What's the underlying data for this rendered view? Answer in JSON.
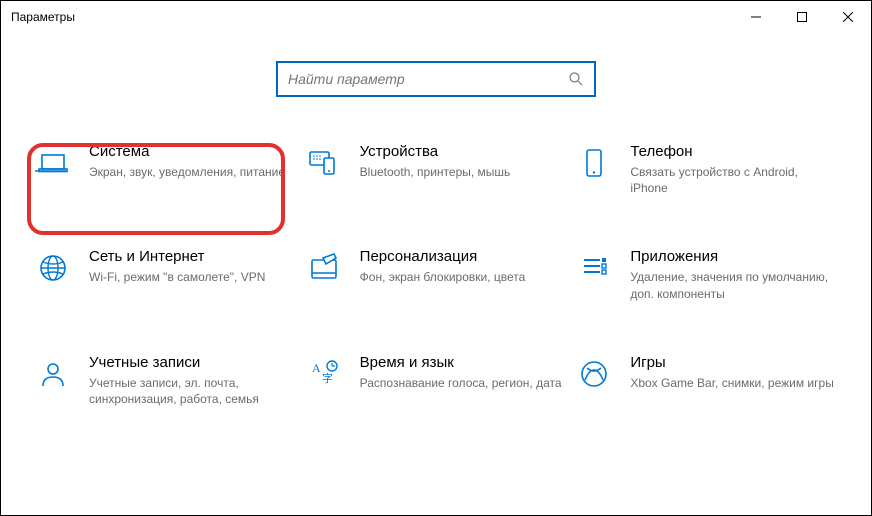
{
  "window": {
    "title": "Параметры"
  },
  "search": {
    "placeholder": "Найти параметр"
  },
  "tiles": {
    "system": {
      "title": "Система",
      "desc": "Экран, звук, уведомления, питание"
    },
    "devices": {
      "title": "Устройства",
      "desc": "Bluetooth, принтеры, мышь"
    },
    "phone": {
      "title": "Телефон",
      "desc": "Связать устройство с Android, iPhone"
    },
    "network": {
      "title": "Сеть и Интернет",
      "desc": "Wi-Fi, режим \"в самолете\", VPN"
    },
    "personal": {
      "title": "Персонализация",
      "desc": "Фон, экран блокировки, цвета"
    },
    "apps": {
      "title": "Приложения",
      "desc": "Удаление, значения по умолчанию, доп. компоненты"
    },
    "accounts": {
      "title": "Учетные записи",
      "desc": "Учетные записи, эл. почта, синхронизация, работа, семья"
    },
    "time": {
      "title": "Время и язык",
      "desc": "Распознавание голоса, регион, дата"
    },
    "gaming": {
      "title": "Игры",
      "desc": "Xbox Game Bar, снимки, режим игры"
    }
  },
  "accent": "#0078d4"
}
